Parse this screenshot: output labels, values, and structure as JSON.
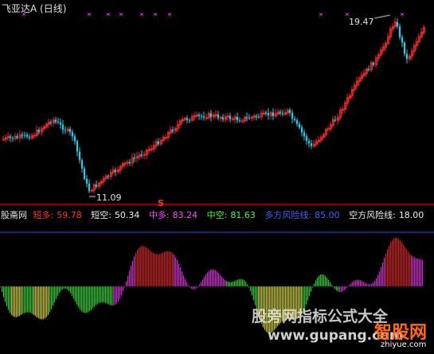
{
  "title": {
    "stock": "飞亚达A",
    "period": "(日线)"
  },
  "price_labels": {
    "high": "19.47",
    "low": "11.09",
    "signal": "S"
  },
  "indicator": {
    "name": "股斋网",
    "items": [
      {
        "label": "短多:",
        "value": "59.78",
        "color": "#ff3030"
      },
      {
        "label": "短空:",
        "value": "50.34",
        "color": "#f0f0f0"
      },
      {
        "label": "中多:",
        "value": "83.24",
        "color": "#ff40ff"
      },
      {
        "label": "中空:",
        "value": "81.63",
        "color": "#40ff40"
      },
      {
        "label": "多方风险线:",
        "value": "85.00",
        "color": "#4060ff"
      },
      {
        "label": "空方风险线:",
        "value": "18.00",
        "color": "#f0f0f0"
      }
    ]
  },
  "watermark": {
    "text1": "股旁网指标公式大全",
    "text2": "www.gupang.com",
    "logo_text": "智股网",
    "logo_url": "zhiyue.com"
  },
  "chart_data": {
    "type": "candlestick+histogram",
    "stock": "飞亚达A",
    "price_high": 19.47,
    "price_low": 11.09,
    "indicator_levels": {
      "多方风险线": 85.0,
      "空方风险线": 18.0
    },
    "latest": {
      "短多": 59.78,
      "短空": 50.34,
      "中多": 83.24,
      "中空": 81.63
    }
  },
  "colors": {
    "up": "#ff3030",
    "down": "#40e0ff",
    "marker": "#ff40ff",
    "divider": "#a00000",
    "risk_line": "#3050ff"
  }
}
